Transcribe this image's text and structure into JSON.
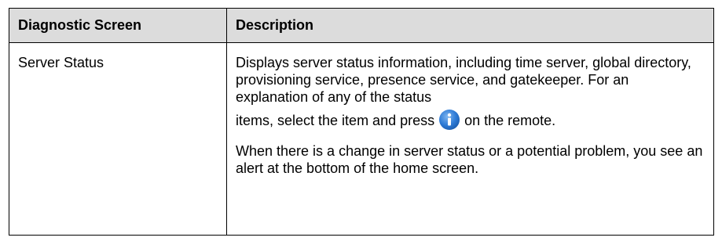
{
  "table": {
    "headers": [
      "Diagnostic Screen",
      "Description"
    ],
    "rows": [
      {
        "screen": "Server Status",
        "description_p1_text": "Displays server status information, including time server, global directory, provisioning service, presence service, and gatekeeper. For an explanation of any of the status",
        "description_p1_before_icon": "items, select the item and press",
        "description_p1_after_icon": "on the remote.",
        "description_p2": "When there is a change in server status or a potential problem, you see an alert at the bottom of the home screen."
      }
    ]
  },
  "icons": {
    "info": "info-icon"
  },
  "colors": {
    "header_bg": "#dcdcdc",
    "info_icon": "#2e7bd6"
  }
}
